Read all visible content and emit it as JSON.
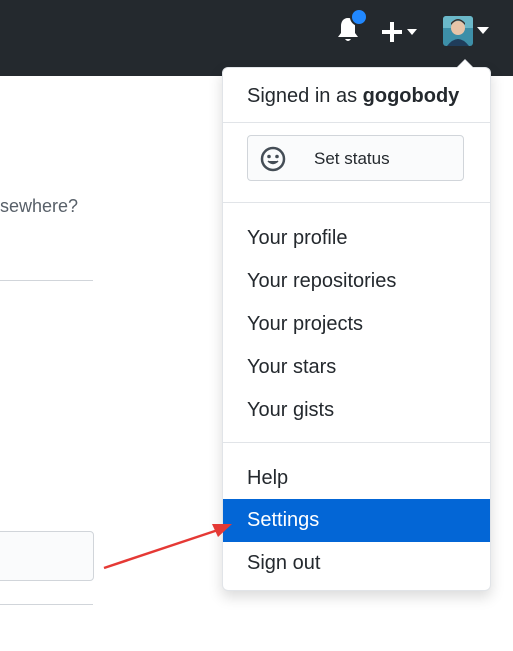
{
  "partial_text": "sewhere?",
  "dropdown": {
    "signed_in_prefix": "Signed in as",
    "username": "gogobody",
    "set_status": "Set status",
    "items": [
      {
        "label": "Your profile"
      },
      {
        "label": "Your repositories"
      },
      {
        "label": "Your projects"
      },
      {
        "label": "Your stars"
      },
      {
        "label": "Your gists"
      }
    ],
    "help": "Help",
    "settings": "Settings",
    "sign_out": "Sign out"
  },
  "colors": {
    "topbar": "#24292e",
    "notification_dot": "#2188ff",
    "active_item": "#0366d6",
    "annotation_arrow": "#e53935"
  },
  "icons": {
    "notification": "bell-icon",
    "create": "plus-icon",
    "status": "smiley-icon"
  }
}
